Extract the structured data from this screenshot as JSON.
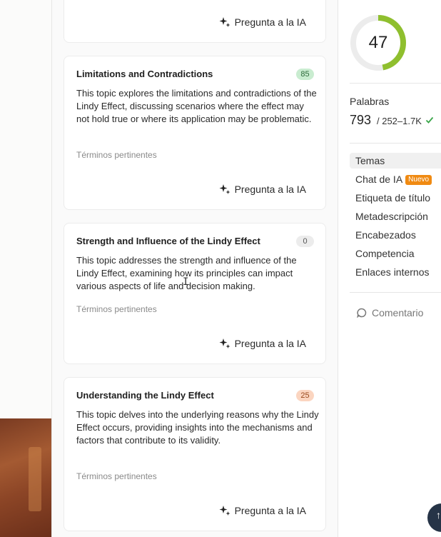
{
  "cards": [
    {
      "title": "",
      "score": "",
      "desc": "",
      "terms": "",
      "ask": "Pregunta a la IA"
    },
    {
      "title": "Limitations and Contradictions",
      "score": "85",
      "desc": "This topic explores the limitations and contradictions of the Lindy Effect, discussing scenarios where the effect may not hold true or where its application may be problematic.",
      "terms": "Términos pertinentes",
      "ask": "Pregunta a la IA"
    },
    {
      "title": "Strength and Influence of the Lindy Effect",
      "score": "0",
      "desc": "This topic addresses the strength and influence of the Lindy Effect, examining how its principles can impact various aspects of life and decision making.",
      "terms": "Términos pertinentes",
      "ask": "Pregunta a la IA"
    },
    {
      "title": "Understanding the Lindy Effect",
      "score": "25",
      "desc": "This topic delves into the underlying reasons why the Lindy Effect occurs, providing insights into the mechanisms and factors that contribute to its validity.",
      "terms": "Términos pertinentes",
      "ask": "Pregunta a la IA"
    }
  ],
  "sidebar": {
    "score": "47",
    "score_fraction": 0.47,
    "words_label": "Palabras",
    "words_count": "793",
    "words_range": "/ 252–1.7K",
    "nav": [
      {
        "label": "Temas"
      },
      {
        "label": "Chat de IA",
        "badge": "Nuevo"
      },
      {
        "label": "Etiqueta de título"
      },
      {
        "label": "Metadescripción"
      },
      {
        "label": "Encabezados"
      },
      {
        "label": "Competencia"
      },
      {
        "label": "Enlaces internos"
      }
    ],
    "comment": "Comentario"
  },
  "colors": {
    "gauge": "#8fbf2e",
    "gauge_track": "#ececec",
    "badge": "#f08a12",
    "check": "#3aa64a"
  },
  "fab_icon": "arrow-up-icon"
}
